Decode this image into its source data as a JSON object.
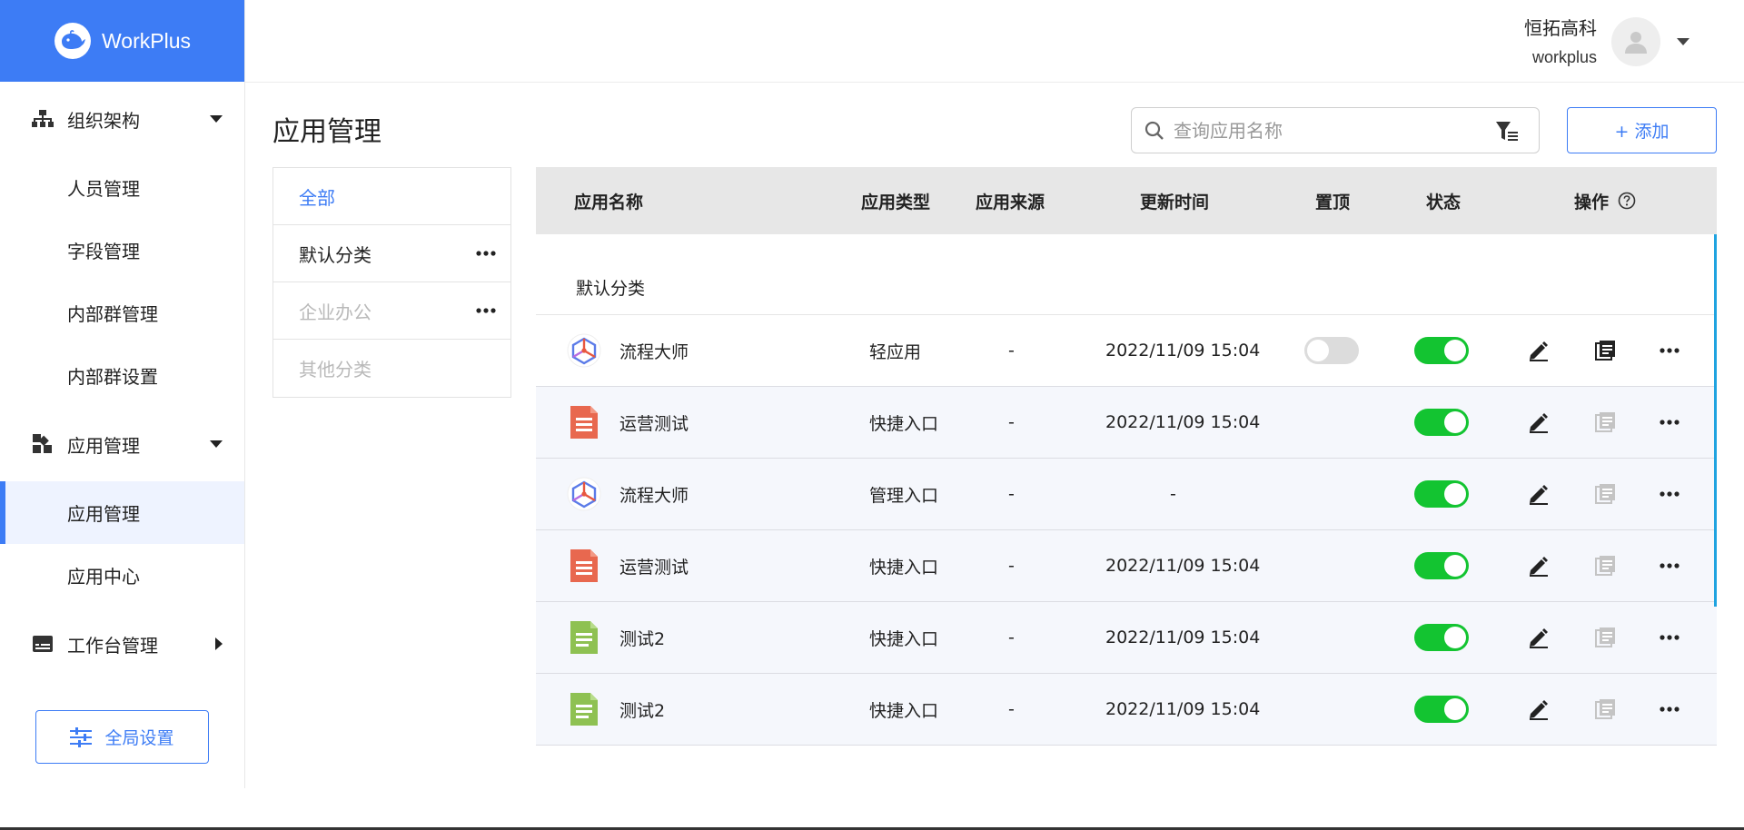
{
  "brand": {
    "name": "WorkPlus",
    "color": "#3d7cf5"
  },
  "sidebar": {
    "groups": [
      {
        "label": "组织架构",
        "icon": "org-chart-icon",
        "expanded": true,
        "items": [
          "人员管理",
          "字段管理",
          "内部群管理",
          "内部群设置"
        ]
      },
      {
        "label": "应用管理",
        "icon": "apps-icon",
        "expanded": true,
        "items": [
          "应用管理",
          "应用中心"
        ],
        "active_item": "应用管理"
      },
      {
        "label": "工作台管理",
        "icon": "workbench-icon",
        "expanded": false,
        "items": []
      }
    ],
    "global_settings_label": "全局设置"
  },
  "header": {
    "company": "恒拓高科",
    "username": "workplus"
  },
  "main": {
    "title": "应用管理",
    "search_placeholder": "查询应用名称",
    "add_label": "+ 添加"
  },
  "categories": [
    {
      "label": "全部",
      "active": true
    },
    {
      "label": "默认分类",
      "has_more": true
    },
    {
      "label": "企业办公",
      "has_more": true,
      "dim": true
    },
    {
      "label": "其他分类",
      "dim": true
    }
  ],
  "table": {
    "columns": [
      "应用名称",
      "应用类型",
      "应用来源",
      "更新时间",
      "置顶",
      "状态",
      "操作"
    ],
    "group_label": "默认分类",
    "rows": [
      {
        "name": "流程大师",
        "icon": "flow-master-icon",
        "type": "轻应用",
        "source": "-",
        "updated": "2022/11/09 15:04",
        "pinned": false,
        "show_pin": true,
        "status": true,
        "copy_enabled": true
      },
      {
        "name": "运营测试",
        "icon": "red-doc-icon",
        "type": "快捷入口",
        "source": "-",
        "updated": "2022/11/09 15:04",
        "show_pin": false,
        "status": true,
        "copy_enabled": false
      },
      {
        "name": "流程大师",
        "icon": "flow-master-icon",
        "type": "管理入口",
        "source": "-",
        "updated": "-",
        "show_pin": false,
        "status": true,
        "copy_enabled": false
      },
      {
        "name": "运营测试",
        "icon": "red-doc-icon",
        "type": "快捷入口",
        "source": "-",
        "updated": "2022/11/09 15:04",
        "show_pin": false,
        "status": true,
        "copy_enabled": false
      },
      {
        "name": "测试2",
        "icon": "green-doc-icon",
        "type": "快捷入口",
        "source": "-",
        "updated": "2022/11/09 15:04",
        "show_pin": false,
        "status": true,
        "copy_enabled": false
      },
      {
        "name": "测试2",
        "icon": "green-doc-icon",
        "type": "快捷入口",
        "source": "-",
        "updated": "2022/11/09 15:04",
        "show_pin": false,
        "status": true,
        "copy_enabled": false
      }
    ]
  },
  "colors": {
    "primary": "#3d7cf5",
    "toggle_on": "#13c431",
    "toggle_off": "#dcdcdc",
    "row_bg": "#f5f7fc"
  }
}
